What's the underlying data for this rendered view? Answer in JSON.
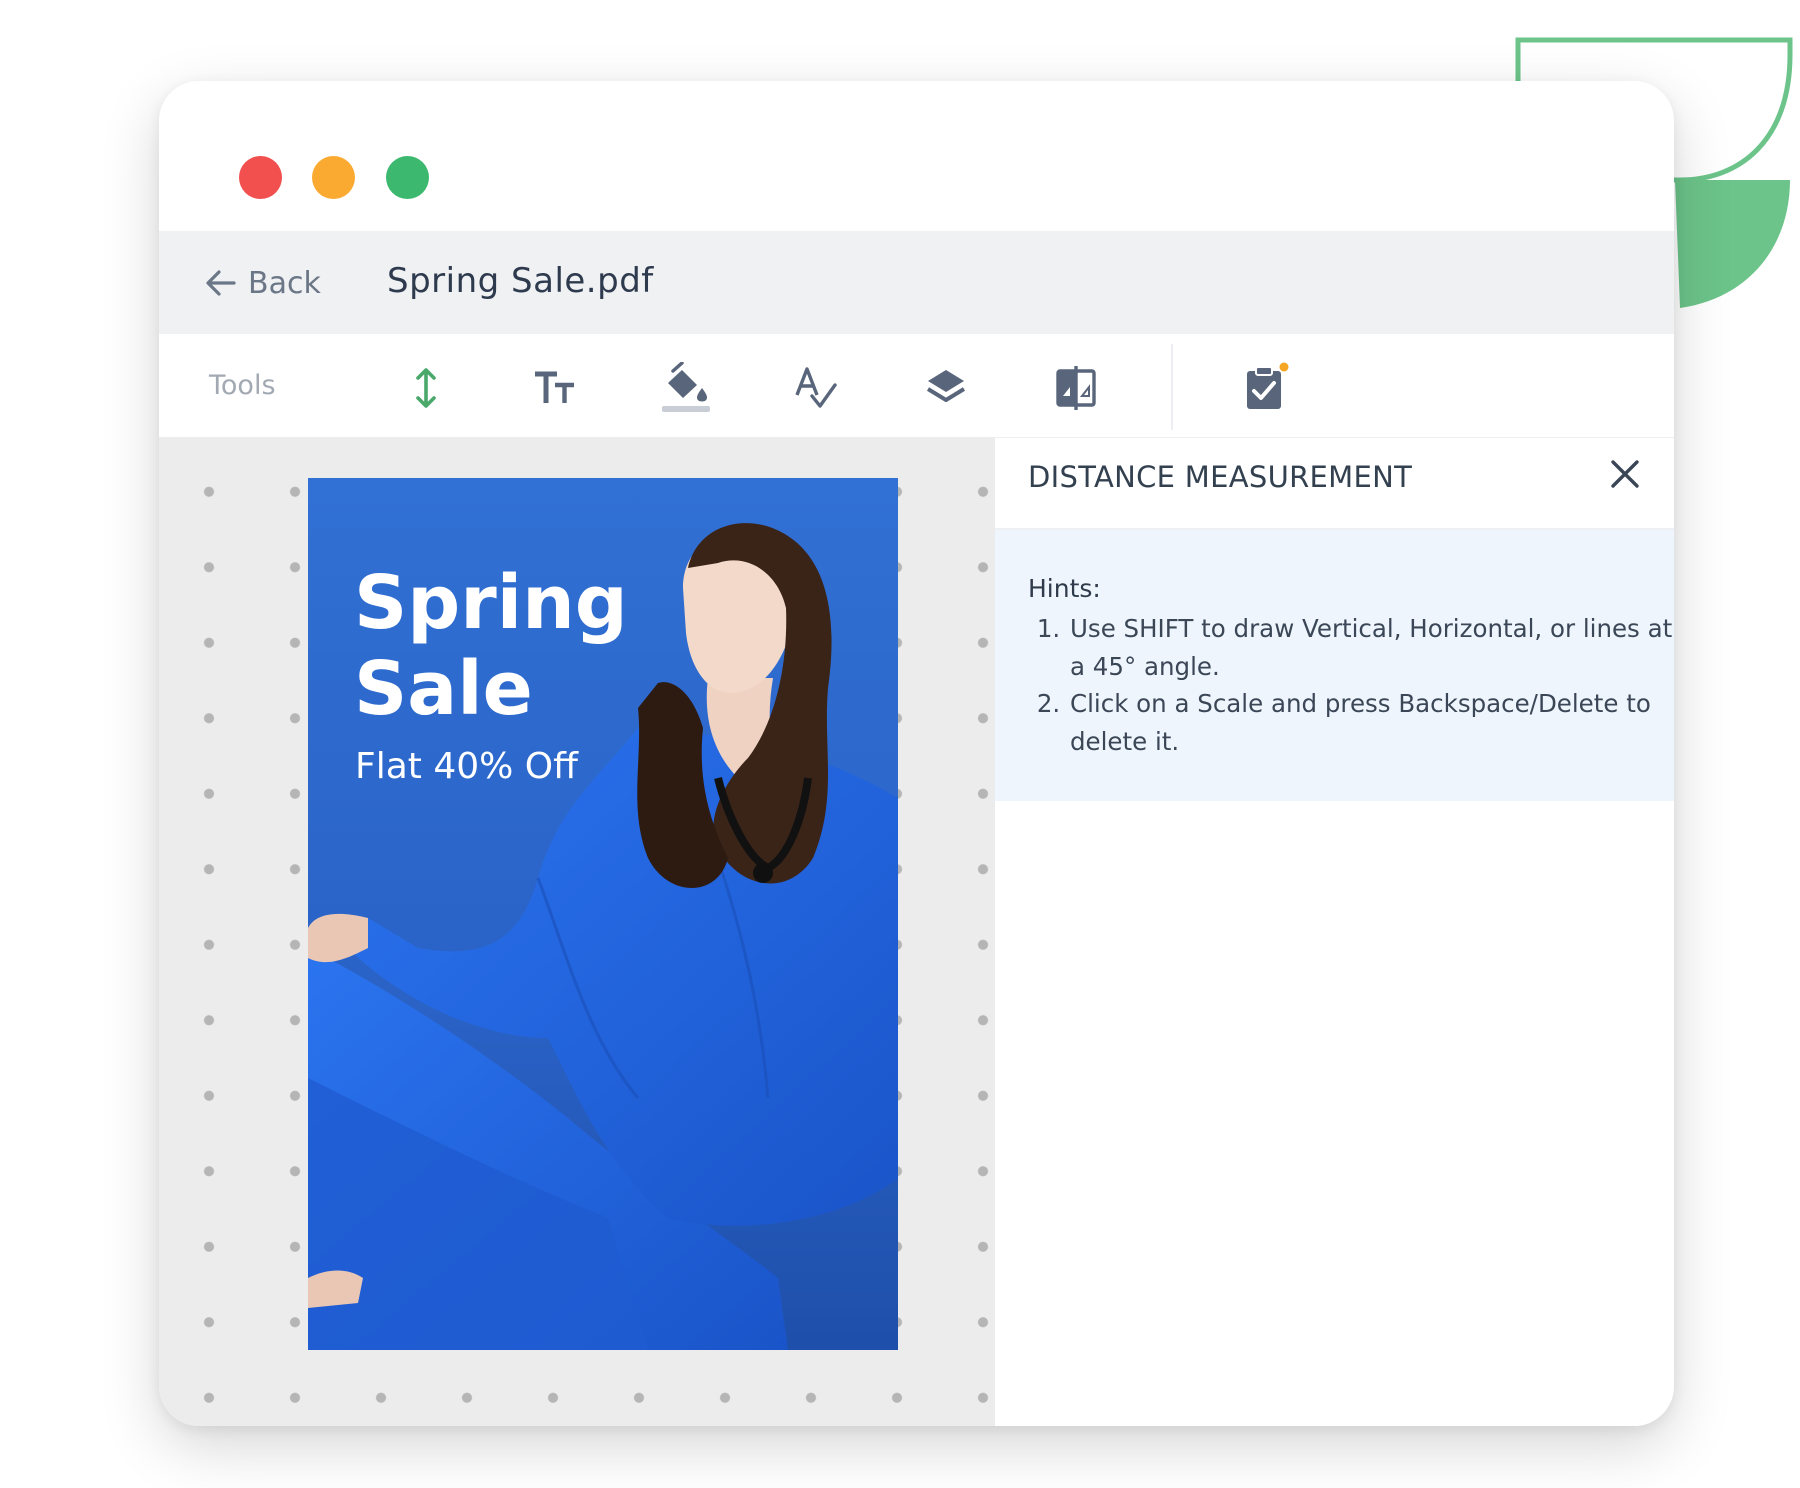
{
  "app": {
    "back_label": "Back",
    "document_title": "Spring Sale.pdf"
  },
  "toolbar": {
    "label": "Tools",
    "tools": [
      {
        "name": "distance-measure",
        "icon": "vertical-arrows-icon",
        "active": true
      },
      {
        "name": "text-size",
        "icon": "text-size-icon"
      },
      {
        "name": "fill-color",
        "icon": "paint-bucket-icon"
      },
      {
        "name": "spell-check",
        "icon": "spell-check-icon"
      },
      {
        "name": "layers",
        "icon": "layers-icon"
      },
      {
        "name": "compare",
        "icon": "compare-icon"
      },
      {
        "name": "checklist",
        "icon": "clipboard-check-icon",
        "badge": true
      }
    ]
  },
  "poster": {
    "title_line1": "Spring",
    "title_line2": "Sale",
    "subtitle": "Flat 40% Off"
  },
  "panel": {
    "title": "DISTANCE MEASUREMENT",
    "hints_title": "Hints:",
    "hints": [
      "Use SHIFT to draw Vertical, Horizontal, or lines at a 45° angle.",
      "Click on a Scale and press Backspace/Delete to delete it."
    ]
  },
  "colors": {
    "accent_green": "#4aa86b",
    "decoration_green": "#6cc48a",
    "traffic_red": "#f24f4f",
    "traffic_yellow": "#fbaa31",
    "traffic_green": "#3db96f",
    "poster_blue": "#2b62c4",
    "badge_orange": "#f5a623"
  }
}
